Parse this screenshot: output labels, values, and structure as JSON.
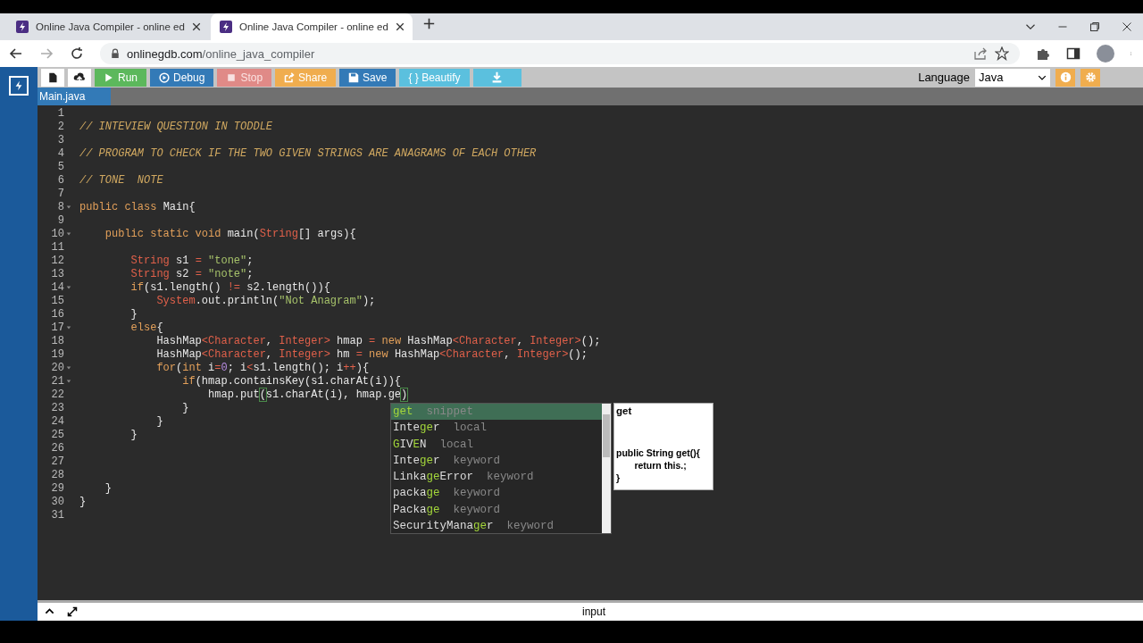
{
  "browser": {
    "tabs": [
      {
        "title": "Online Java Compiler - online ed",
        "selected": false
      },
      {
        "title": "Online Java Compiler - online ed",
        "selected": true
      }
    ],
    "url_host": "onlinegdb.com",
    "url_path": "/online_java_compiler"
  },
  "toolbar": {
    "buttons": [
      {
        "kind": "icon",
        "disabled": false,
        "color": "#ffffff"
      },
      {
        "kind": "icon",
        "disabled": false,
        "color": "#ffffff"
      },
      {
        "kind": "text",
        "label": "Run",
        "disabled": false,
        "color": "#5cb85c"
      },
      {
        "kind": "text",
        "label": "Debug",
        "disabled": false,
        "color": "#337ab7"
      },
      {
        "kind": "text",
        "label": "Stop",
        "disabled": true,
        "color": "#e08a87"
      },
      {
        "kind": "text",
        "label": "Share",
        "disabled": false,
        "color": "#f0ad4e"
      },
      {
        "kind": "text",
        "label": "Save",
        "disabled": false,
        "color": "#337ab7"
      },
      {
        "kind": "text",
        "label": "{ } Beautify",
        "disabled": false,
        "color": "#5bc0de"
      },
      {
        "kind": "icon",
        "disabled": false,
        "color": "#5bc0de"
      }
    ],
    "language_label": "Language",
    "language": "Java"
  },
  "file_tab": "Main.java",
  "editor": {
    "lines": [
      {
        "number": "1",
        "fold": false
      },
      {
        "number": "2",
        "fold": false,
        "tokens": [
          {
            "kind": "comment",
            "text": "// INTEVIEW QUESTION IN TODDLE"
          }
        ]
      },
      {
        "number": "3",
        "fold": false
      },
      {
        "number": "4",
        "fold": false,
        "tokens": [
          {
            "kind": "comment",
            "text": "// PROGRAM TO CHECK IF THE TWO GIVEN STRINGS ARE ANAGRAMS OF EACH OTHER"
          }
        ]
      },
      {
        "number": "5",
        "fold": false
      },
      {
        "number": "6",
        "fold": false,
        "tokens": [
          {
            "kind": "comment",
            "text": "// TONE  NOTE"
          }
        ]
      },
      {
        "number": "7",
        "fold": false
      },
      {
        "number": "8",
        "fold": true,
        "tokens": [
          {
            "kind": "keyword",
            "text": "public class "
          },
          {
            "kind": "plain",
            "text": "Main{"
          }
        ]
      },
      {
        "number": "9",
        "fold": false
      },
      {
        "number": "10",
        "fold": true,
        "tokens": [
          {
            "kind": "keyword",
            "text": "    public static void "
          },
          {
            "kind": "plain",
            "text": "main("
          },
          {
            "kind": "type",
            "text": "String"
          },
          {
            "kind": "plain",
            "text": "[] args){"
          }
        ]
      },
      {
        "number": "11",
        "fold": false
      },
      {
        "number": "12",
        "fold": false,
        "tokens": [
          {
            "kind": "type",
            "text": "        String"
          },
          {
            "kind": "plain",
            "text": " s1 "
          },
          {
            "kind": "type",
            "text": "="
          },
          {
            "kind": "string",
            "text": " \"tone\""
          },
          {
            "kind": "plain",
            "text": ";"
          }
        ]
      },
      {
        "number": "13",
        "fold": false,
        "tokens": [
          {
            "kind": "type",
            "text": "        String"
          },
          {
            "kind": "plain",
            "text": " s2 "
          },
          {
            "kind": "type",
            "text": "="
          },
          {
            "kind": "string",
            "text": " \"note\""
          },
          {
            "kind": "plain",
            "text": ";"
          }
        ]
      },
      {
        "number": "14",
        "fold": true,
        "tokens": [
          {
            "kind": "keyword",
            "text": "        if"
          },
          {
            "kind": "plain",
            "text": "(s1.length() "
          },
          {
            "kind": "type",
            "text": "!="
          },
          {
            "kind": "plain",
            "text": " s2.length()){"
          }
        ]
      },
      {
        "number": "15",
        "fold": false,
        "tokens": [
          {
            "kind": "type",
            "text": "            System"
          },
          {
            "kind": "plain",
            "text": ".out.println("
          },
          {
            "kind": "string",
            "text": "\"Not Anagram\""
          },
          {
            "kind": "plain",
            "text": ");"
          }
        ]
      },
      {
        "number": "16",
        "fold": false,
        "tokens": [
          {
            "kind": "plain",
            "text": "        }"
          }
        ]
      },
      {
        "number": "17",
        "fold": true,
        "tokens": [
          {
            "kind": "keyword",
            "text": "        else"
          },
          {
            "kind": "plain",
            "text": "{"
          }
        ]
      },
      {
        "number": "18",
        "fold": false,
        "tokens": [
          {
            "kind": "plain",
            "text": "            HashMap"
          },
          {
            "kind": "type",
            "text": "<Character"
          },
          {
            "kind": "plain",
            "text": ", "
          },
          {
            "kind": "type",
            "text": "Integer>"
          },
          {
            "kind": "plain",
            "text": " hmap "
          },
          {
            "kind": "type",
            "text": "="
          },
          {
            "kind": "keyword",
            "text": " new "
          },
          {
            "kind": "plain",
            "text": "HashMap"
          },
          {
            "kind": "type",
            "text": "<Character"
          },
          {
            "kind": "plain",
            "text": ", "
          },
          {
            "kind": "type",
            "text": "Integer>"
          },
          {
            "kind": "plain",
            "text": "();"
          }
        ]
      },
      {
        "number": "19",
        "fold": false,
        "tokens": [
          {
            "kind": "plain",
            "text": "            HashMap"
          },
          {
            "kind": "type",
            "text": "<Character"
          },
          {
            "kind": "plain",
            "text": ", "
          },
          {
            "kind": "type",
            "text": "Integer>"
          },
          {
            "kind": "plain",
            "text": " hm "
          },
          {
            "kind": "type",
            "text": "="
          },
          {
            "kind": "keyword",
            "text": " new "
          },
          {
            "kind": "plain",
            "text": "HashMap"
          },
          {
            "kind": "type",
            "text": "<Character"
          },
          {
            "kind": "plain",
            "text": ", "
          },
          {
            "kind": "type",
            "text": "Integer>"
          },
          {
            "kind": "plain",
            "text": "();"
          }
        ]
      },
      {
        "number": "20",
        "fold": true,
        "tokens": [
          {
            "kind": "keyword",
            "text": "            for"
          },
          {
            "kind": "plain",
            "text": "("
          },
          {
            "kind": "keyword",
            "text": "int"
          },
          {
            "kind": "plain",
            "text": " i"
          },
          {
            "kind": "type",
            "text": "="
          },
          {
            "kind": "number",
            "text": "0"
          },
          {
            "kind": "plain",
            "text": "; i"
          },
          {
            "kind": "type",
            "text": "<"
          },
          {
            "kind": "plain",
            "text": "s1.length(); i"
          },
          {
            "kind": "type",
            "text": "++"
          },
          {
            "kind": "plain",
            "text": "){"
          }
        ]
      },
      {
        "number": "21",
        "fold": true,
        "tokens": [
          {
            "kind": "keyword",
            "text": "                if"
          },
          {
            "kind": "plain",
            "text": "(hmap.containsKey(s1.charAt(i)){"
          }
        ]
      },
      {
        "number": "22",
        "fold": false,
        "tokens": [
          {
            "kind": "plain",
            "text": "                    hmap.put"
          },
          {
            "kind": "bracket",
            "text": "("
          },
          {
            "kind": "plain",
            "text": "s1.charAt(i), hmap.ge"
          },
          {
            "kind": "bracket",
            "text": ")"
          }
        ]
      },
      {
        "number": "23",
        "fold": false,
        "tokens": [
          {
            "kind": "plain",
            "text": "                }"
          }
        ]
      },
      {
        "number": "24",
        "fold": false,
        "tokens": [
          {
            "kind": "plain",
            "text": "            }"
          }
        ]
      },
      {
        "number": "25",
        "fold": false,
        "tokens": [
          {
            "kind": "plain",
            "text": "        }"
          }
        ]
      },
      {
        "number": "26",
        "fold": false
      },
      {
        "number": "27",
        "fold": false
      },
      {
        "number": "28",
        "fold": false
      },
      {
        "number": "29",
        "fold": false,
        "tokens": [
          {
            "kind": "plain",
            "text": "    }"
          }
        ]
      },
      {
        "number": "30",
        "fold": false,
        "tokens": [
          {
            "kind": "plain",
            "text": "}"
          }
        ]
      },
      {
        "number": "31",
        "fold": false
      }
    ]
  },
  "autocomplete": {
    "items": [
      {
        "selected": true,
        "parts": [
          {
            "text": "get",
            "match": true
          }
        ],
        "type": "snippet"
      },
      {
        "selected": false,
        "parts": [
          {
            "text": "Inte",
            "match": false
          },
          {
            "text": "ge",
            "match": true
          },
          {
            "text": "r",
            "match": false
          }
        ],
        "type": "local"
      },
      {
        "selected": false,
        "parts": [
          {
            "text": "G",
            "match": true
          },
          {
            "text": "IV",
            "match": false
          },
          {
            "text": "E",
            "match": true
          },
          {
            "text": "N",
            "match": false
          }
        ],
        "type": "local"
      },
      {
        "selected": false,
        "parts": [
          {
            "text": "Inte",
            "match": false
          },
          {
            "text": "ge",
            "match": true
          },
          {
            "text": "r",
            "match": false
          }
        ],
        "type": "keyword"
      },
      {
        "selected": false,
        "parts": [
          {
            "text": "Linka",
            "match": false
          },
          {
            "text": "ge",
            "match": true
          },
          {
            "text": "Error",
            "match": false
          }
        ],
        "type": "keyword"
      },
      {
        "selected": false,
        "parts": [
          {
            "text": "packa",
            "match": false
          },
          {
            "text": "ge",
            "match": true
          }
        ],
        "type": "keyword"
      },
      {
        "selected": false,
        "parts": [
          {
            "text": "Packa",
            "match": false
          },
          {
            "text": "ge",
            "match": true
          }
        ],
        "type": "keyword"
      },
      {
        "selected": false,
        "parts": [
          {
            "text": "SecurityMana",
            "match": false
          },
          {
            "text": "ge",
            "match": true
          },
          {
            "text": "r",
            "match": false
          }
        ],
        "type": "keyword"
      }
    ],
    "doc_title": "get",
    "doc_lines": [
      "public String get(){",
      "return this.;",
      "}"
    ]
  },
  "bottom_panel": {
    "title": "input"
  }
}
